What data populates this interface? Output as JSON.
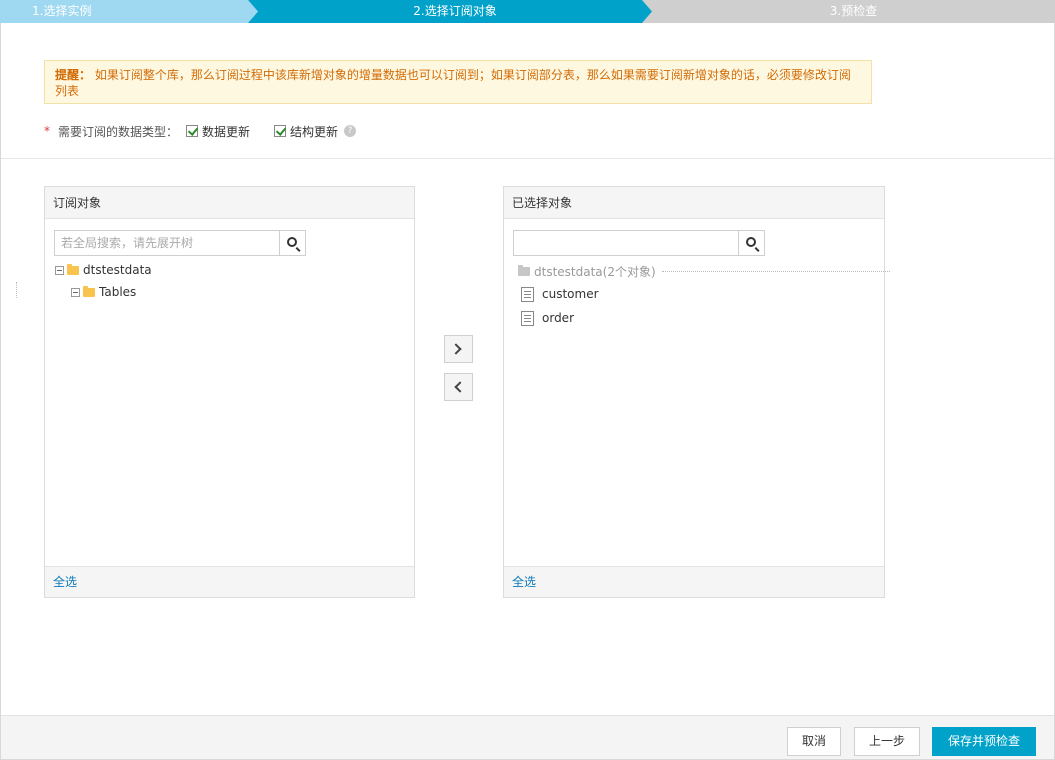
{
  "steps": [
    {
      "label": "1.选择实例"
    },
    {
      "label": "2.选择订阅对象"
    },
    {
      "label": "3.预检查"
    }
  ],
  "tip": {
    "prefix": "提醒：",
    "text": "如果订阅整个库，那么订阅过程中该库新增对象的增量数据也可以订阅到；如果订阅部分表，那么如果需要订阅新增对象的话，必须要修改订阅列表"
  },
  "data_types": {
    "required_mark": "*",
    "label": "需要订阅的数据类型：",
    "options": [
      {
        "label": "数据更新",
        "checked": true
      },
      {
        "label": "结构更新",
        "checked": true
      }
    ],
    "help_icon": "question-circle-icon"
  },
  "left_panel": {
    "title": "订阅对象",
    "search_placeholder": "若全局搜索，请先展开树",
    "tree": {
      "db_name": "dtstestdata",
      "child_label": "Tables"
    },
    "select_all": "全选"
  },
  "right_panel": {
    "title": "已选择对象",
    "search_value": "",
    "tree": {
      "db_label": "dtstestdata(2个对象)",
      "items": [
        "customer",
        "order"
      ]
    },
    "select_all": "全选"
  },
  "transfer": {
    "add_icon": "chevron-right-icon",
    "remove_icon": "chevron-left-icon"
  },
  "footer": {
    "cancel": "取消",
    "prev": "上一步",
    "save": "保存并预检查"
  },
  "colors": {
    "active_step": "#00a2ca",
    "done_step": "#9fd8f1",
    "pending_step": "#cfcfcf",
    "tip_text": "#d26b06",
    "link": "#0b79b8"
  }
}
